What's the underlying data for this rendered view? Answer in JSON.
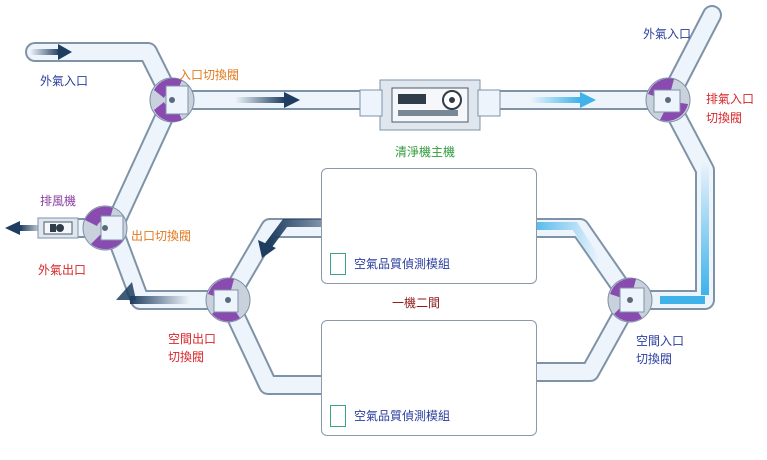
{
  "colors": {
    "pipe_fill": "#eef4fb",
    "pipe_stroke": "#7f93a8",
    "valve_purple": "#8a4bb0",
    "arrow_dark": "#1f3d60",
    "arrow_light": "#3fb2ea",
    "label_blue": "#2b3f9e",
    "label_orange": "#e07a1e",
    "label_red": "#d8262b",
    "label_green": "#2f9b3c",
    "label_purple": "#8a3fa0",
    "label_darkred": "#8b1a1a",
    "sensor_green": "#3aa58a"
  },
  "labels": {
    "outside_air_in_left": "外氣入口",
    "inlet_switch_valve": "入口切換閥",
    "outside_air_in_right": "外氣入口",
    "exhaust_inlet_valve_1": "排氣入口",
    "exhaust_inlet_valve_2": "切換閥",
    "purifier_main": "清淨機主機",
    "exhaust_fan": "排風機",
    "outlet_switch_valve": "出口切換閥",
    "outside_air_out": "外氣出口",
    "room_outlet_valve_1": "空間出口",
    "room_outlet_valve_2": "切換閥",
    "room_inlet_valve_1": "空間入口",
    "room_inlet_valve_2": "切換閥",
    "one_machine_two_rooms": "一機二間"
  },
  "rooms": [
    {
      "sensor_label": "空氣品質偵測模組"
    },
    {
      "sensor_label": "空氣品質偵測模組"
    }
  ],
  "icons": [
    "valve-icon",
    "purifier-icon",
    "fan-icon",
    "sensor-icon",
    "flow-arrow-icon"
  ]
}
